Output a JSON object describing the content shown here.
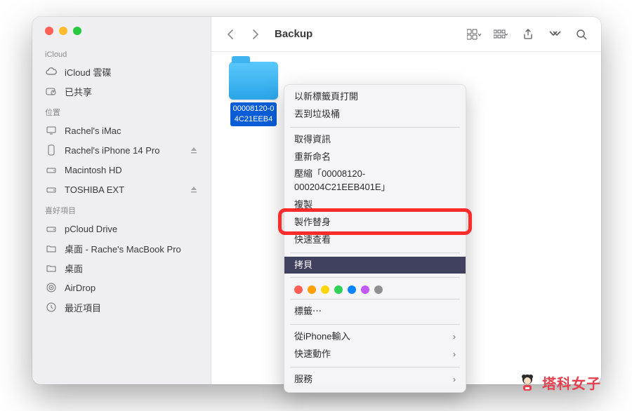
{
  "window": {
    "title": "Backup",
    "traffic": {
      "close": "#ff5f57",
      "min": "#febc2e",
      "max": "#28c840"
    }
  },
  "sidebar": {
    "sections": [
      {
        "label": "iCloud",
        "items": [
          {
            "icon": "cloud",
            "label": "iCloud 雲碟"
          },
          {
            "icon": "shared",
            "label": "已共享"
          }
        ]
      },
      {
        "label": "位置",
        "items": [
          {
            "icon": "imac",
            "label": "Rachel's iMac"
          },
          {
            "icon": "iphone",
            "label": "Rachel's  iPhone 14 Pro",
            "eject": true
          },
          {
            "icon": "disk",
            "label": "Macintosh HD"
          },
          {
            "icon": "disk",
            "label": "TOSHIBA EXT",
            "eject": true
          }
        ]
      },
      {
        "label": "喜好項目",
        "items": [
          {
            "icon": "disk",
            "label": "pCloud Drive"
          },
          {
            "icon": "folder",
            "label": "桌面 - Rache's MacBook Pro"
          },
          {
            "icon": "folder",
            "label": "桌面"
          },
          {
            "icon": "airdrop",
            "label": "AirDrop"
          },
          {
            "icon": "clock",
            "label": "最近項目"
          }
        ]
      }
    ]
  },
  "folder": {
    "name_line1": "00008120-0",
    "name_line2": "4C21EEB4"
  },
  "context_menu": {
    "groups": [
      [
        {
          "label": "以新標籤頁打開"
        },
        {
          "label": "丟到垃圾桶"
        }
      ],
      [
        {
          "label": "取得資訊"
        },
        {
          "label": "重新命名"
        },
        {
          "label": "壓縮「00008120-000204C21EEB401E」"
        },
        {
          "label": "複製"
        },
        {
          "label": "製作替身"
        },
        {
          "label": "快速查看"
        }
      ],
      [
        {
          "label": "拷貝",
          "selected": true
        }
      ],
      "tags",
      [
        {
          "label": "標籤⋯"
        }
      ],
      [
        {
          "label": "從iPhone輸入",
          "submenu": true
        },
        {
          "label": "快速動作",
          "submenu": true
        }
      ],
      [
        {
          "label": "服務",
          "submenu": true
        }
      ]
    ],
    "tag_colors": [
      "#ff5e57",
      "#ff9f0a",
      "#ffd60a",
      "#30d158",
      "#0a84ff",
      "#bf5af2",
      "#8e8e93"
    ]
  },
  "brand": {
    "text": "塔科女子"
  }
}
